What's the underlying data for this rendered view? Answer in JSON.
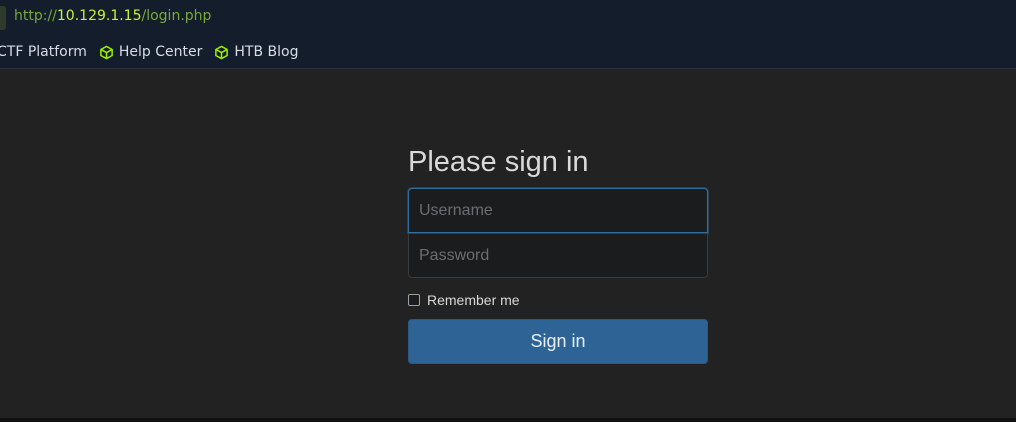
{
  "browser": {
    "url": {
      "scheme": "http://",
      "host": "10.129.1.15",
      "path": "/login.php"
    },
    "bookmarks": [
      {
        "label": "CTF Platform",
        "icon": "none"
      },
      {
        "label": "Help Center",
        "icon": "cube-icon"
      },
      {
        "label": "HTB Blog",
        "icon": "cube-icon"
      }
    ]
  },
  "login": {
    "title": "Please sign in",
    "username_placeholder": "Username",
    "username_value": "",
    "password_placeholder": "Password",
    "password_value": "",
    "remember_label": "Remember me",
    "remember_checked": false,
    "submit_label": "Sign in"
  },
  "colors": {
    "accent": "#9fef00",
    "button": "#2e6396",
    "background": "#222222",
    "chrome": "#141d2b"
  }
}
